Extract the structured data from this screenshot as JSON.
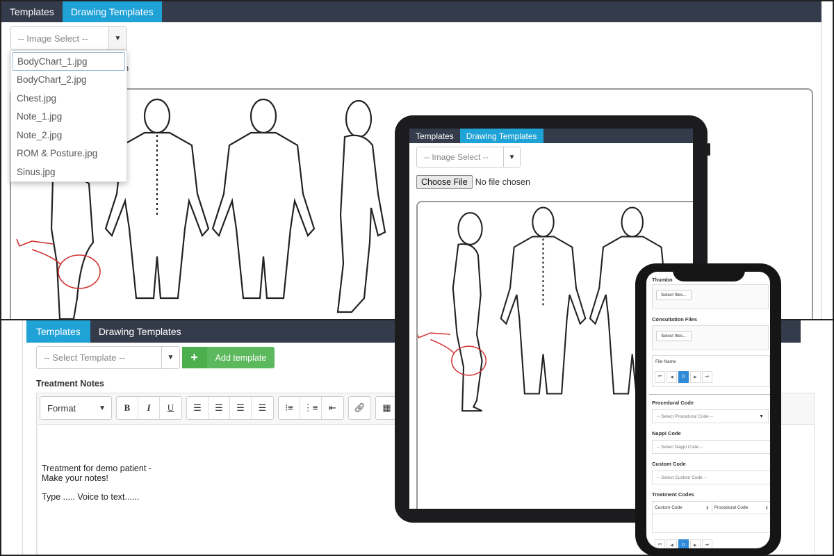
{
  "top": {
    "tabs": [
      "Templates",
      "Drawing Templates"
    ],
    "image_select_placeholder": "-- Image Select --",
    "image_options": [
      "BodyChart_1.jpg",
      "BodyChart_2.jpg",
      "Chest.jpg",
      "Note_1.jpg",
      "Note_2.jpg",
      "ROM & Posture.jpg",
      "Sinus.jpg"
    ],
    "selected_option": "BodyChart_1.jpg",
    "partial_text": "n"
  },
  "bottom": {
    "tabs": [
      "Templates",
      "Drawing Templates"
    ],
    "template_select_placeholder": "-- Select Template --",
    "add_template_label": "Add template",
    "treatment_notes_title": "Treatment Notes",
    "format_label": "Format",
    "note_lines": [
      "Treatment for demo patient -",
      "Make your notes!",
      "Type ..... Voice to text......"
    ]
  },
  "tablet": {
    "tabs": [
      "Templates",
      "Drawing Templates"
    ],
    "image_select_placeholder": "-- Image Select --",
    "choose_file_label": "Choose File",
    "no_file_text": "No file chosen"
  },
  "phone": {
    "thumbnail_label": "Thumbn",
    "select_files_label": "Select files...",
    "consultation_files_label": "Consultation Files",
    "select_files_label_2": "Select files...",
    "file_name_label": "File Name",
    "page_number": "0",
    "procedural_code_label": "Procedural Code",
    "procedural_code_placeholder": "-- Select Procedural Code --",
    "nappi_code_label": "Nappi Code",
    "nappi_code_placeholder": "-- Select Nappi Code --",
    "custom_code_label": "Custom Code",
    "custom_code_placeholder": "-- Select Custom Code --",
    "treatment_codes_label": "Treatment Codes",
    "col_custom_code": "Custom Code",
    "col_procedural_code": "Procedural Code",
    "page_number_2": "0"
  },
  "colors": {
    "tabbar": "#343b4b",
    "active_tab": "#1fa2d6",
    "green": "#5cb85c",
    "pager_active": "#2f8ad8",
    "annotation": "#d03030"
  }
}
